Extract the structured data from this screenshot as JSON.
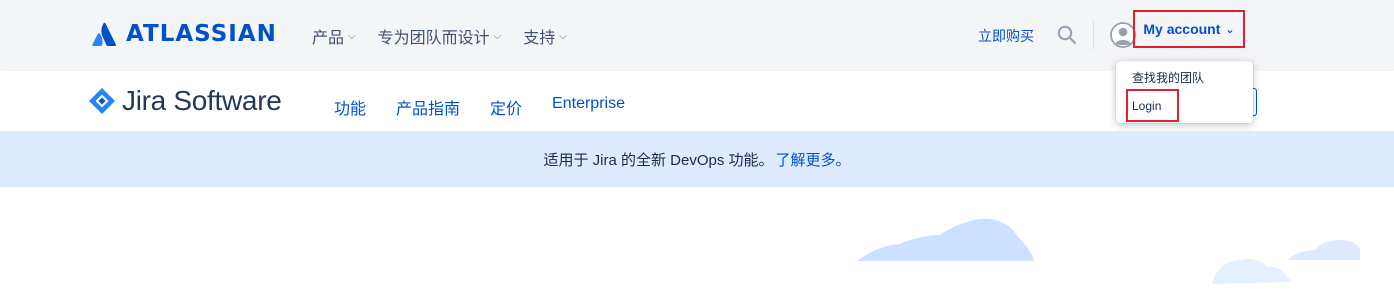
{
  "topnav": {
    "brand": "ATLASSIAN",
    "menu": [
      {
        "label": "产品"
      },
      {
        "label": "专为团队而设计"
      },
      {
        "label": "支持"
      }
    ],
    "buy_label": "立即购买",
    "search_icon": "search-icon",
    "account_label": "My account"
  },
  "account_dropdown": {
    "items": [
      {
        "label": "查找我的团队"
      },
      {
        "label": "Login"
      }
    ]
  },
  "prodnav": {
    "brand": "Jira Software",
    "menu": [
      {
        "label": "功能"
      },
      {
        "label": "产品指南"
      },
      {
        "label": "定价"
      },
      {
        "label": "Enterprise"
      }
    ]
  },
  "banner": {
    "text": "适用于 Jira 的全新 DevOps 功能。",
    "link": "了解更多。"
  },
  "colors": {
    "brand_blue": "#0052cc",
    "topnav_bg": "#f4f5f7",
    "banner_bg": "#deebff",
    "highlight_red": "#e5202e",
    "cloud": "#cce0ff"
  }
}
